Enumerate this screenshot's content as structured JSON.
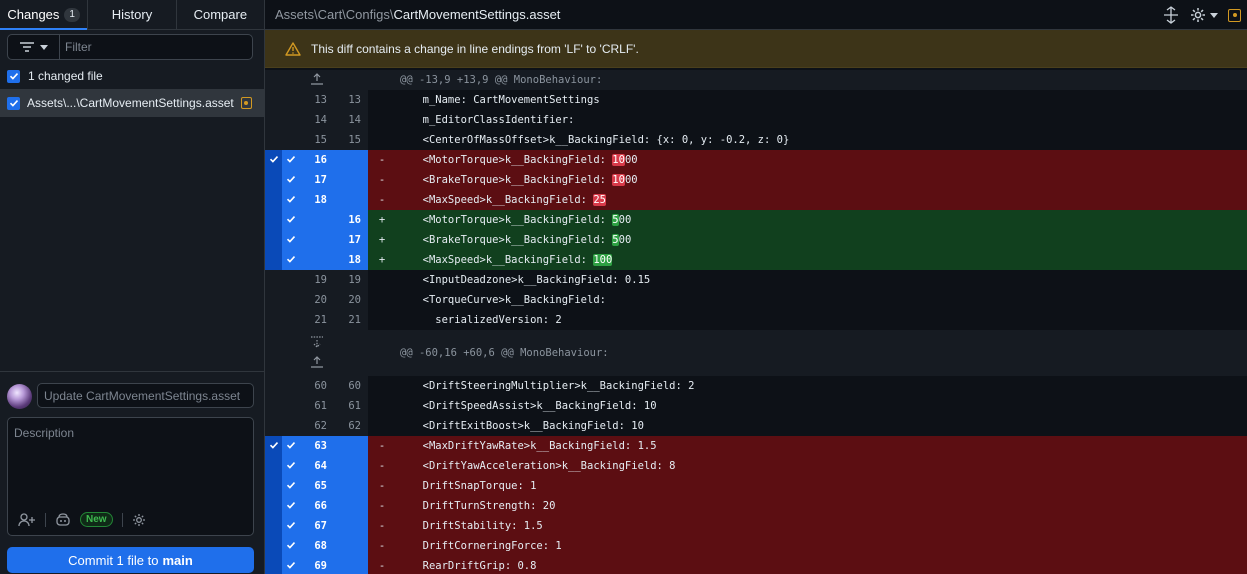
{
  "tabs": [
    {
      "label": "Changes",
      "badge": "1"
    },
    {
      "label": "History"
    },
    {
      "label": "Compare"
    }
  ],
  "filter": {
    "placeholder": "Filter"
  },
  "changed_label": "1 changed file",
  "file": {
    "name": "Assets\\...\\CartMovementSettings.asset"
  },
  "commit": {
    "summary_placeholder": "Update CartMovementSettings.asset",
    "description_placeholder": "Description",
    "new_badge": "New",
    "button_prefix": "Commit 1 file to",
    "branch": "main"
  },
  "path": {
    "dir": "Assets\\Cart\\Configs\\",
    "file": "CartMovementSettings.asset"
  },
  "warning": "This diff contains a change in line endings from 'LF' to 'CRLF'.",
  "colors": {
    "accent": "#1f6feb",
    "deleted": "#5c0e12",
    "added": "#11401e",
    "warning_bg": "#3d3418",
    "warning_icon": "#d29922"
  },
  "diff": [
    {
      "type": "hunk",
      "text": "@@ -13,9 +13,9 @@ MonoBehaviour:",
      "expand": "up"
    },
    {
      "type": "ctx",
      "o": "13",
      "n": "13",
      "text": "  m_Name: CartMovementSettings"
    },
    {
      "type": "ctx",
      "o": "14",
      "n": "14",
      "text": "  m_EditorClassIdentifier: "
    },
    {
      "type": "ctx",
      "o": "15",
      "n": "15",
      "text": "  <CenterOfMassOffset>k__BackingField: {x: 0, y: -0.2, z: 0}"
    },
    {
      "type": "del",
      "o": "16",
      "n": "",
      "pre": "  <MotorTorque>k__BackingField: ",
      "hl": "10",
      "post": "00",
      "sel": true
    },
    {
      "type": "del",
      "o": "17",
      "n": "",
      "pre": "  <BrakeTorque>k__BackingField: ",
      "hl": "10",
      "post": "00",
      "sel": false
    },
    {
      "type": "del",
      "o": "18",
      "n": "",
      "pre": "  <MaxSpeed>k__BackingField: ",
      "hl": "25",
      "post": "",
      "sel": false
    },
    {
      "type": "add",
      "o": "",
      "n": "16",
      "pre": "  <MotorTorque>k__BackingField: ",
      "hl": "5",
      "post": "00",
      "sel": false
    },
    {
      "type": "add",
      "o": "",
      "n": "17",
      "pre": "  <BrakeTorque>k__BackingField: ",
      "hl": "5",
      "post": "00",
      "sel": false
    },
    {
      "type": "add",
      "o": "",
      "n": "18",
      "pre": "  <MaxSpeed>k__BackingField: ",
      "hl": "100",
      "post": "",
      "sel": false
    },
    {
      "type": "ctx",
      "o": "19",
      "n": "19",
      "text": "  <InputDeadzone>k__BackingField: 0.15"
    },
    {
      "type": "ctx",
      "o": "20",
      "n": "20",
      "text": "  <TorqueCurve>k__BackingField:"
    },
    {
      "type": "ctx",
      "o": "21",
      "n": "21",
      "text": "    serializedVersion: 2"
    },
    {
      "type": "hunk",
      "text": "@@ -60,16 +60,6 @@ MonoBehaviour:",
      "expand": "both"
    },
    {
      "type": "ctx",
      "o": "60",
      "n": "60",
      "text": "  <DriftSteeringMultiplier>k__BackingField: 2"
    },
    {
      "type": "ctx",
      "o": "61",
      "n": "61",
      "text": "  <DriftSpeedAssist>k__BackingField: 10"
    },
    {
      "type": "ctx",
      "o": "62",
      "n": "62",
      "text": "  <DriftExitBoost>k__BackingField: 10"
    },
    {
      "type": "del",
      "o": "63",
      "n": "",
      "pre": "  <MaxDriftYawRate>k__BackingField: 1.5",
      "hl": "",
      "post": "",
      "sel": true
    },
    {
      "type": "del",
      "o": "64",
      "n": "",
      "pre": "  <DriftYawAcceleration>k__BackingField: 8",
      "hl": "",
      "post": "",
      "sel": false
    },
    {
      "type": "del",
      "o": "65",
      "n": "",
      "pre": "  DriftSnapTorque: 1",
      "hl": "",
      "post": "",
      "sel": false
    },
    {
      "type": "del",
      "o": "66",
      "n": "",
      "pre": "  DriftTurnStrength: 20",
      "hl": "",
      "post": "",
      "sel": false
    },
    {
      "type": "del",
      "o": "67",
      "n": "",
      "pre": "  DriftStability: 1.5",
      "hl": "",
      "post": "",
      "sel": false
    },
    {
      "type": "del",
      "o": "68",
      "n": "",
      "pre": "  DriftCorneringForce: 1",
      "hl": "",
      "post": "",
      "sel": false
    },
    {
      "type": "del",
      "o": "69",
      "n": "",
      "pre": "  RearDriftGrip: 0.8",
      "hl": "",
      "post": "",
      "sel": false
    }
  ]
}
